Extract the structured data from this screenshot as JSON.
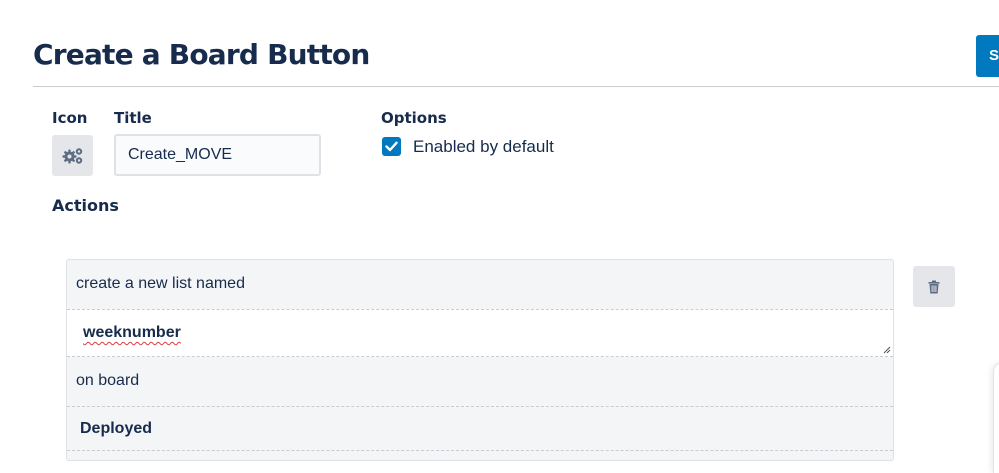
{
  "header": {
    "title": "Create a Board Button",
    "save_label": "S"
  },
  "form": {
    "icon_label": "Icon",
    "icon_name": "gears-icon",
    "title_label": "Title",
    "title_value": "Create_MOVE",
    "options_label": "Options",
    "enabled_checked": true,
    "enabled_label": "Enabled by default",
    "actions_label": "Actions"
  },
  "action": {
    "text_1": "create a new list named",
    "list_name_value": "weeknumber",
    "text_2": "on board",
    "board_value": "Deployed",
    "delete_icon": "trash-icon"
  },
  "colors": {
    "accent": "#0079bf",
    "heading": "#172b4d",
    "button_bg": "#e4e6ea"
  }
}
